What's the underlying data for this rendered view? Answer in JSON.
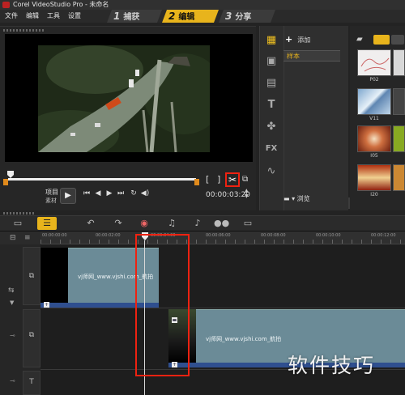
{
  "window": {
    "title": "Corel VideoStudio Pro - 未命名"
  },
  "menu": [
    "文件",
    "编辑",
    "工具",
    "设置"
  ],
  "steps": [
    {
      "num": "1",
      "label": "捕获",
      "active": false
    },
    {
      "num": "2",
      "label": "编辑",
      "active": true
    },
    {
      "num": "3",
      "label": "分享",
      "active": false
    }
  ],
  "player": {
    "project_label": "项目",
    "clip_label": "素材",
    "timecode": "00:00:03:20",
    "mark_in": "[",
    "mark_out": "]",
    "cut_icon": "scissors-icon"
  },
  "library": {
    "add_label": "添加",
    "folder_item": "样本",
    "browse_label": "浏览",
    "thumbnails": [
      "P02",
      "V11",
      "I05",
      "I20"
    ],
    "side_icons": [
      "media-icon",
      "transition-icon",
      "title-icon",
      "text-icon",
      "graphic-icon",
      "fx-icon",
      "path-icon"
    ]
  },
  "ruler": {
    "labels": [
      "00:00:00:00",
      "00:00:02:00",
      "00:00:04:00",
      "00:00:06:00",
      "00:00:08:00",
      "00:00:10:00",
      "00:00:12:00"
    ]
  },
  "clips": [
    {
      "text": "vj师网_www.vjshi.com_航拍"
    },
    {
      "text": "vj师网_www.vjshi.com_航拍"
    }
  ],
  "watermark": "软件技巧",
  "colors": {
    "accent": "#e8b41c",
    "highlight": "#e21111",
    "clip": "#6b8b97"
  }
}
